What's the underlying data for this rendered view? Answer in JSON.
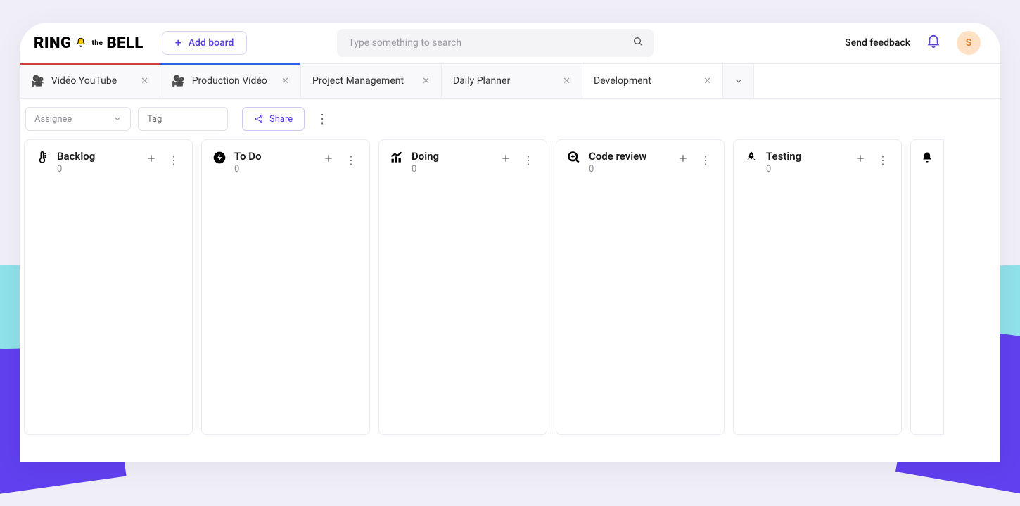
{
  "header": {
    "logo_left": "RING",
    "logo_the": "the",
    "logo_right": "BELL",
    "add_board_label": "Add board",
    "search_placeholder": "Type something to search",
    "send_feedback": "Send feedback",
    "avatar_initial": "S"
  },
  "tabs": [
    {
      "label": "Vidéo YouTube",
      "icon": "🎥",
      "color": "red",
      "active": false
    },
    {
      "label": "Production Vidéo",
      "icon": "🎥",
      "color": "blue",
      "active": false
    },
    {
      "label": "Project Management",
      "icon": "",
      "color": "plain",
      "active": false
    },
    {
      "label": "Daily Planner",
      "icon": "",
      "color": "plain",
      "active": false
    },
    {
      "label": "Development",
      "icon": "",
      "color": "plain",
      "active": true
    }
  ],
  "filters": {
    "assignee_label": "Assignee",
    "tag_placeholder": "Tag",
    "share_label": "Share"
  },
  "columns": [
    {
      "title": "Backlog",
      "count": "0",
      "icon": "thermometer"
    },
    {
      "title": "To Do",
      "count": "0",
      "icon": "bolt"
    },
    {
      "title": "Doing",
      "count": "0",
      "icon": "chart-up"
    },
    {
      "title": "Code review",
      "count": "0",
      "icon": "magnify"
    },
    {
      "title": "Testing",
      "count": "0",
      "icon": "rocket"
    }
  ],
  "peek_column_icon": "bell"
}
